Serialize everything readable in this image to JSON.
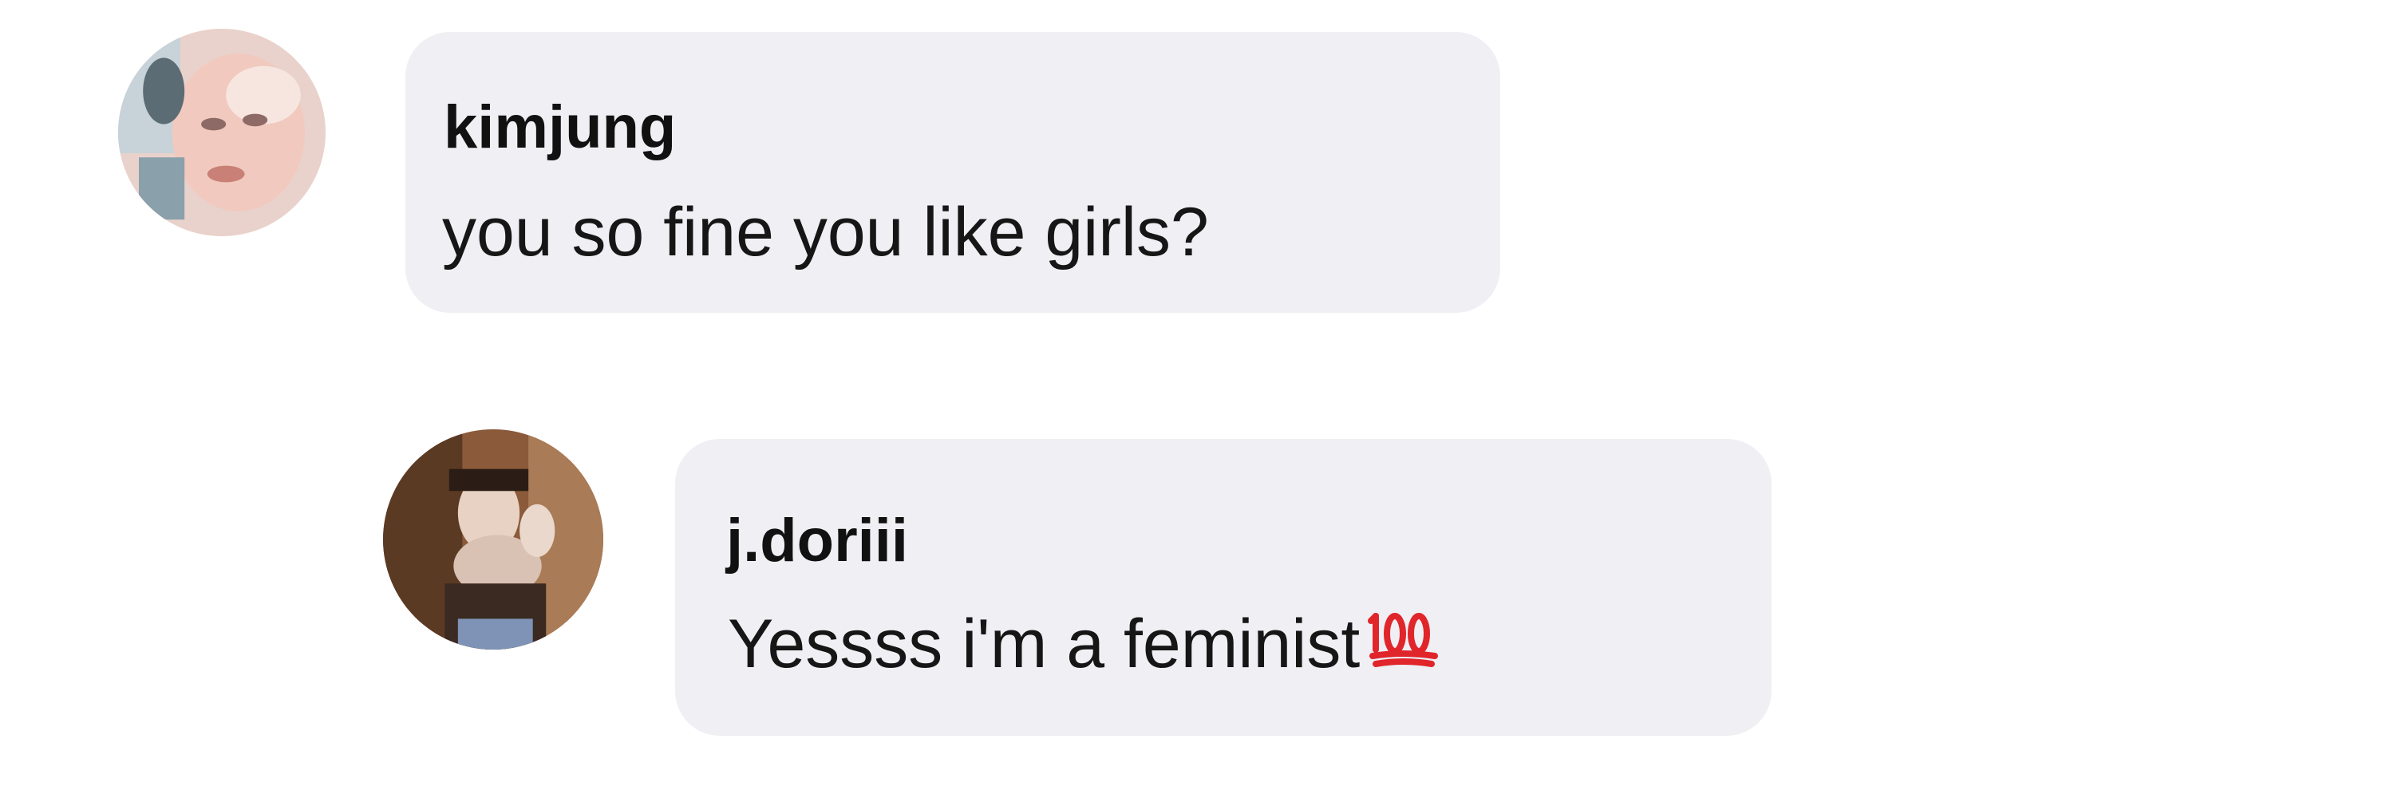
{
  "comments": [
    {
      "username": "kimjung",
      "text": "you so fine you like girls?",
      "avatar_icon": "profile-photo-avatar"
    },
    {
      "username": "j.doriii",
      "text": "Yessss i'm a feminist",
      "emoji_icon": "hundred-points-emoji",
      "avatar_icon": "profile-photo-avatar"
    }
  ],
  "colors": {
    "background": "#ffffff",
    "bubble": "#efeff4",
    "text": "#161616",
    "emoji_red": "#e0252b"
  }
}
